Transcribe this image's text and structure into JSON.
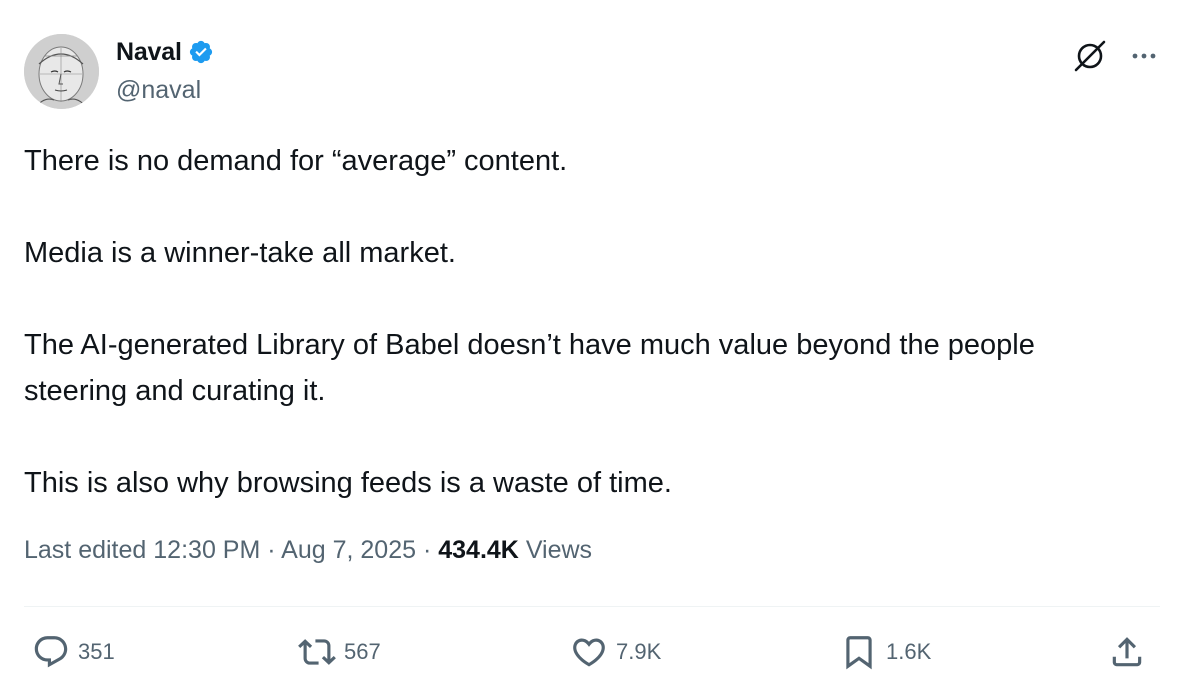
{
  "author": {
    "display_name": "Naval",
    "handle": "@naval",
    "verified": true
  },
  "tweet": {
    "paragraphs": [
      "There is no demand for “average” content.",
      "Media is a winner-take all market.",
      "The AI-generated Library of Babel doesn’t have much value beyond the people steering and curating it.",
      "This is also why browsing feeds is a waste of time."
    ]
  },
  "meta": {
    "edited_prefix": "Last edited",
    "time": "12:30 PM",
    "date": "Aug 7, 2025",
    "separator": "·",
    "views_count": "434.4K",
    "views_label": "Views"
  },
  "actions": {
    "replies": "351",
    "reposts": "567",
    "likes": "7.9K",
    "bookmarks": "1.6K"
  },
  "icons": {
    "verified": "verified-badge-icon",
    "grok": "grok-icon",
    "more": "more-icon",
    "reply": "reply-icon",
    "repost": "repost-icon",
    "like": "heart-icon",
    "bookmark": "bookmark-icon",
    "share": "share-icon"
  },
  "colors": {
    "text_primary": "#0f1419",
    "text_secondary": "#536471",
    "verified_blue": "#1d9bf0",
    "divider": "#eff3f4"
  }
}
